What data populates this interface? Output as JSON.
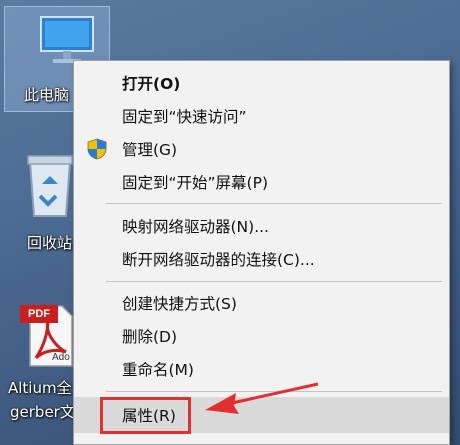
{
  "desktop": {
    "icons": [
      {
        "label": "此电脑",
        "name": "this-pc"
      },
      {
        "label": "回收站",
        "name": "recycle-bin"
      },
      {
        "label": "Altium全",
        "label2": "gerber文",
        "name": "altium-pdf",
        "badge": "PDF",
        "sublabel": "Ado"
      }
    ]
  },
  "menu": {
    "open": "打开(O)",
    "pin_quick": "固定到“快速访问”",
    "manage": "管理(G)",
    "pin_start": "固定到“开始”屏幕(P)",
    "map_drive": "映射网络驱动器(N)...",
    "disconnect_drive": "断开网络驱动器的连接(C)...",
    "create_shortcut": "创建快捷方式(S)",
    "delete": "删除(D)",
    "rename": "重命名(M)",
    "properties": "属性(R)"
  },
  "colors": {
    "annotation": "#e03030",
    "menu_bg": "#f2f2f2",
    "hover_bg": "#dadada"
  }
}
